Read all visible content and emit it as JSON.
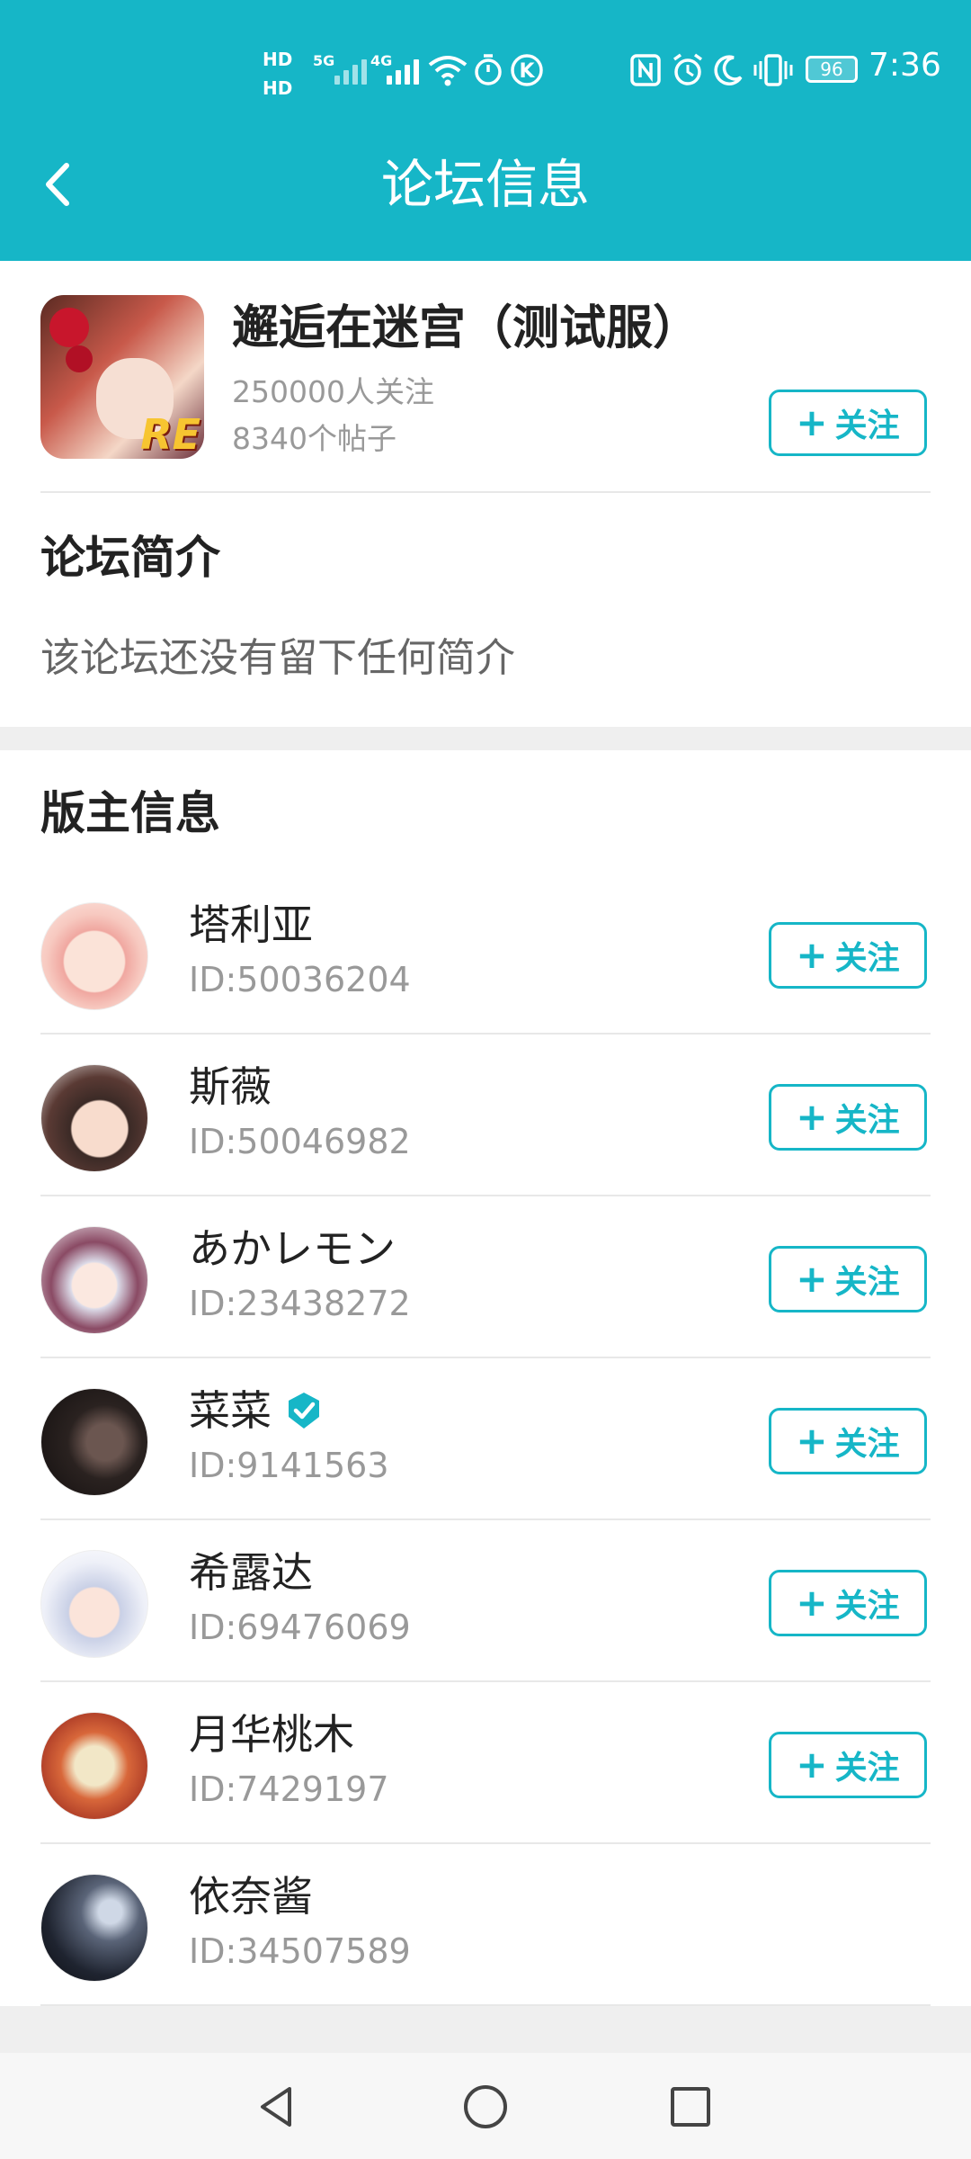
{
  "status_bar": {
    "hd1": "HD",
    "hd2": "HD",
    "net1": "5G",
    "net2": "4G",
    "battery": "96",
    "time": "7:36"
  },
  "header": {
    "title": "论坛信息",
    "back_icon": "chevron-left-icon"
  },
  "forum": {
    "name": "邂逅在迷宫（测试服）",
    "followers": "250000人关注",
    "posts": "8340个帖子",
    "icon_badge": "RE",
    "follow_label": "关注"
  },
  "intro": {
    "title": "论坛简介",
    "text": "该论坛还没有留下任何简介"
  },
  "moderators": {
    "title": "版主信息",
    "items": [
      {
        "name": "塔利亚",
        "id": "ID:50036204",
        "follow": "关注",
        "verified": false
      },
      {
        "name": "斯薇",
        "id": "ID:50046982",
        "follow": "关注",
        "verified": false
      },
      {
        "name": "あかレモン",
        "id": "ID:23438272",
        "follow": "关注",
        "verified": false
      },
      {
        "name": "菜菜",
        "id": "ID:9141563",
        "follow": "关注",
        "verified": true
      },
      {
        "name": "希露达",
        "id": "ID:69476069",
        "follow": "关注",
        "verified": false
      },
      {
        "name": "月华桃木",
        "id": "ID:7429197",
        "follow": "关注",
        "verified": false
      },
      {
        "name": "依奈酱",
        "id": "ID:34507589",
        "follow": "",
        "verified": false
      }
    ]
  },
  "colors": {
    "accent": "#16b6c7",
    "background": "#ffffff",
    "muted_text": "#999999"
  },
  "navbar": {
    "back": "triangle-back-icon",
    "home": "circle-home-icon",
    "recents": "square-recents-icon"
  }
}
